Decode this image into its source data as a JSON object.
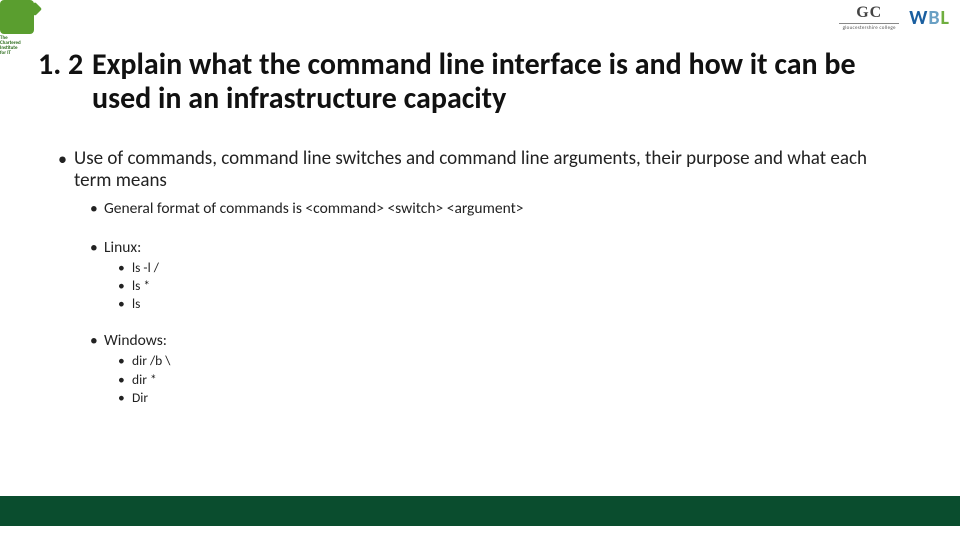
{
  "logos": {
    "bcs_tag_l1": "The",
    "bcs_tag_l2": "Chartered",
    "bcs_tag_l3": "Institute",
    "bcs_tag_l4": "for IT",
    "gc_initials": "GC",
    "gc_subtitle": "gloucestershire college",
    "wbl_w": "W",
    "wbl_b": "B",
    "wbl_l": "L"
  },
  "title": {
    "number": "1. 2",
    "text": "Explain what the command line interface is and how it can be used in an infrastructure capacity"
  },
  "body": {
    "main_bullet": "Use of commands, command line switches and command line arguments, their purpose and what each term means",
    "format_line": "General format of commands is <command> <switch> <argument>",
    "linux_label": "Linux:",
    "linux_items": [
      "ls -l /",
      "ls *",
      "ls"
    ],
    "windows_label": "Windows:",
    "windows_items": [
      "dir /b \\",
      "dir *",
      "Dir"
    ]
  },
  "bullet_glyph": "•"
}
